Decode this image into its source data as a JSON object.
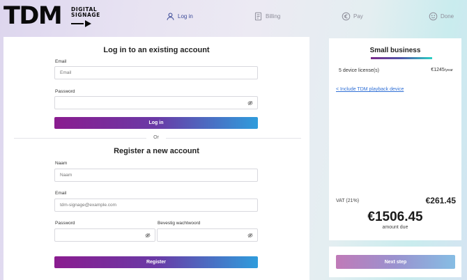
{
  "logo": {
    "main": "TDM",
    "line1": "DIGITAL",
    "line2": "SIGNAGE"
  },
  "steps": [
    {
      "label": "Log in",
      "icon": "user-icon",
      "active": true
    },
    {
      "label": "Billing",
      "icon": "invoice-icon",
      "active": false
    },
    {
      "label": "Pay",
      "icon": "euro-icon",
      "active": false
    },
    {
      "label": "Done",
      "icon": "smiley-icon",
      "active": false
    }
  ],
  "login": {
    "title": "Log in to an existing account",
    "email_label": "Email",
    "email_placeholder": "Email",
    "password_label": "Password",
    "password_value": "",
    "button_label": "Log in"
  },
  "or_label": "Or",
  "register": {
    "title": "Register a new account",
    "name_label": "Naam",
    "name_placeholder": "Naam",
    "email_label": "Email",
    "email_placeholder": "tdm-signage@example.com",
    "password_label": "Password",
    "confirm_label": "Bevestig wachtwoord",
    "button_label": "Register"
  },
  "summary": {
    "title": "Small business",
    "license_label": "5 device license(s)",
    "license_price": "€1245",
    "license_period": "/year",
    "include_link": "< Include TDM playback device",
    "vat_label": "VAT (21%)",
    "vat_amount": "€261.45",
    "total_amount": "€1506.45",
    "total_label": "amount due"
  },
  "next_button": "Next step",
  "colors": {
    "accent_start": "#8a1c8f",
    "accent_end": "#2f9cdc",
    "link": "#2f6fd6",
    "active_step": "#3b4a98"
  }
}
